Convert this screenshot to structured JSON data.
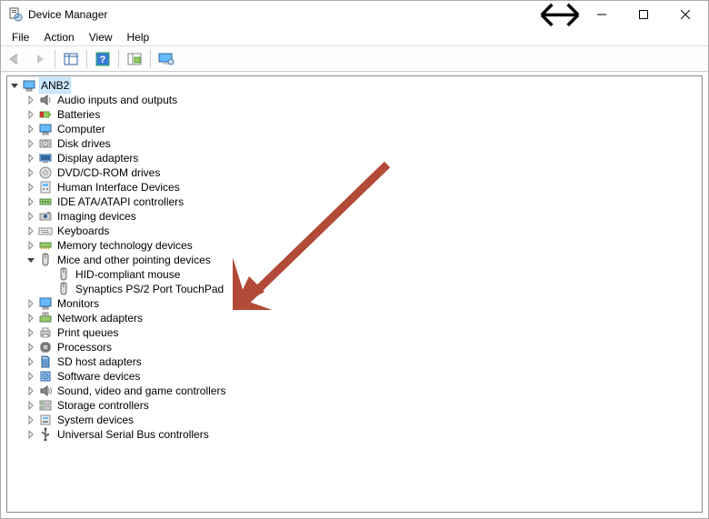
{
  "title": "Device Manager",
  "menus": {
    "file": "File",
    "action": "Action",
    "view": "View",
    "help": "Help"
  },
  "toolbar": {
    "back": "back",
    "forward": "forward",
    "show_hide": "show-hide",
    "help": "help",
    "scan": "scan",
    "monitor": "monitor"
  },
  "tree": {
    "root": "ANB2",
    "categories": [
      {
        "label": "Audio inputs and outputs",
        "icon": "speaker-icon"
      },
      {
        "label": "Batteries",
        "icon": "battery-icon"
      },
      {
        "label": "Computer",
        "icon": "computer-icon"
      },
      {
        "label": "Disk drives",
        "icon": "disk-icon"
      },
      {
        "label": "Display adapters",
        "icon": "display-adapter-icon"
      },
      {
        "label": "DVD/CD-ROM drives",
        "icon": "optical-icon"
      },
      {
        "label": "Human Interface Devices",
        "icon": "hid-icon"
      },
      {
        "label": "IDE ATA/ATAPI controllers",
        "icon": "ide-icon"
      },
      {
        "label": "Imaging devices",
        "icon": "imaging-icon"
      },
      {
        "label": "Keyboards",
        "icon": "keyboard-icon"
      },
      {
        "label": "Memory technology devices",
        "icon": "memory-icon"
      },
      {
        "label": "Mice and other pointing devices",
        "icon": "mouse-icon",
        "expanded": true,
        "children": [
          {
            "label": "HID-compliant mouse",
            "icon": "mouse-icon"
          },
          {
            "label": "Synaptics PS/2 Port TouchPad",
            "icon": "mouse-icon"
          }
        ]
      },
      {
        "label": "Monitors",
        "icon": "monitor-icon"
      },
      {
        "label": "Network adapters",
        "icon": "network-icon"
      },
      {
        "label": "Print queues",
        "icon": "printer-icon"
      },
      {
        "label": "Processors",
        "icon": "cpu-icon"
      },
      {
        "label": "SD host adapters",
        "icon": "sd-icon"
      },
      {
        "label": "Software devices",
        "icon": "software-icon"
      },
      {
        "label": "Sound, video and game controllers",
        "icon": "sound-icon"
      },
      {
        "label": "Storage controllers",
        "icon": "storage-icon"
      },
      {
        "label": "System devices",
        "icon": "system-icon"
      },
      {
        "label": "Universal Serial Bus controllers",
        "icon": "usb-icon"
      }
    ]
  },
  "annotation": {
    "arrow_color": "#b14a36"
  }
}
